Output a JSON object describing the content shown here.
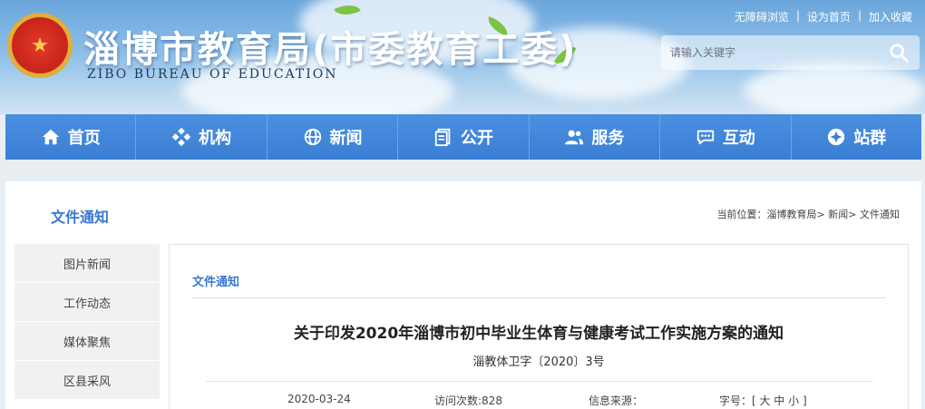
{
  "header": {
    "title": "淄博市教育局(市委教育工委)",
    "subtitle": "ZIBO BUREAU OF EDUCATION",
    "links": [
      "无障碍浏览",
      "设为首页",
      "加入收藏"
    ],
    "search_placeholder": "请输入关键字"
  },
  "nav": [
    {
      "label": "首页",
      "icon": "home-icon"
    },
    {
      "label": "机构",
      "icon": "org-icon"
    },
    {
      "label": "新闻",
      "icon": "globe-icon"
    },
    {
      "label": "公开",
      "icon": "document-icon"
    },
    {
      "label": "服务",
      "icon": "users-icon"
    },
    {
      "label": "互动",
      "icon": "chat-icon"
    },
    {
      "label": "站群",
      "icon": "cross-circle-icon"
    }
  ],
  "page": {
    "section_title": "文件通知",
    "breadcrumb": "当前位置：淄博教育局> 新闻> 文件通知"
  },
  "sidebar": [
    "图片新闻",
    "工作动态",
    "媒体聚焦",
    "区县采风"
  ],
  "article": {
    "category": "文件通知",
    "title": "关于印发2020年淄博市初中毕业生体育与健康考试工作实施方案的通知",
    "doc_no": "淄教体卫字〔2020〕3号",
    "date": "2020-03-24",
    "views": "访问次数:828",
    "source": "信息来源：",
    "font_size": "字号：[ 大 中 小 ]"
  },
  "colors": {
    "nav": "#3a7fd4",
    "accent": "#3b78d0"
  }
}
